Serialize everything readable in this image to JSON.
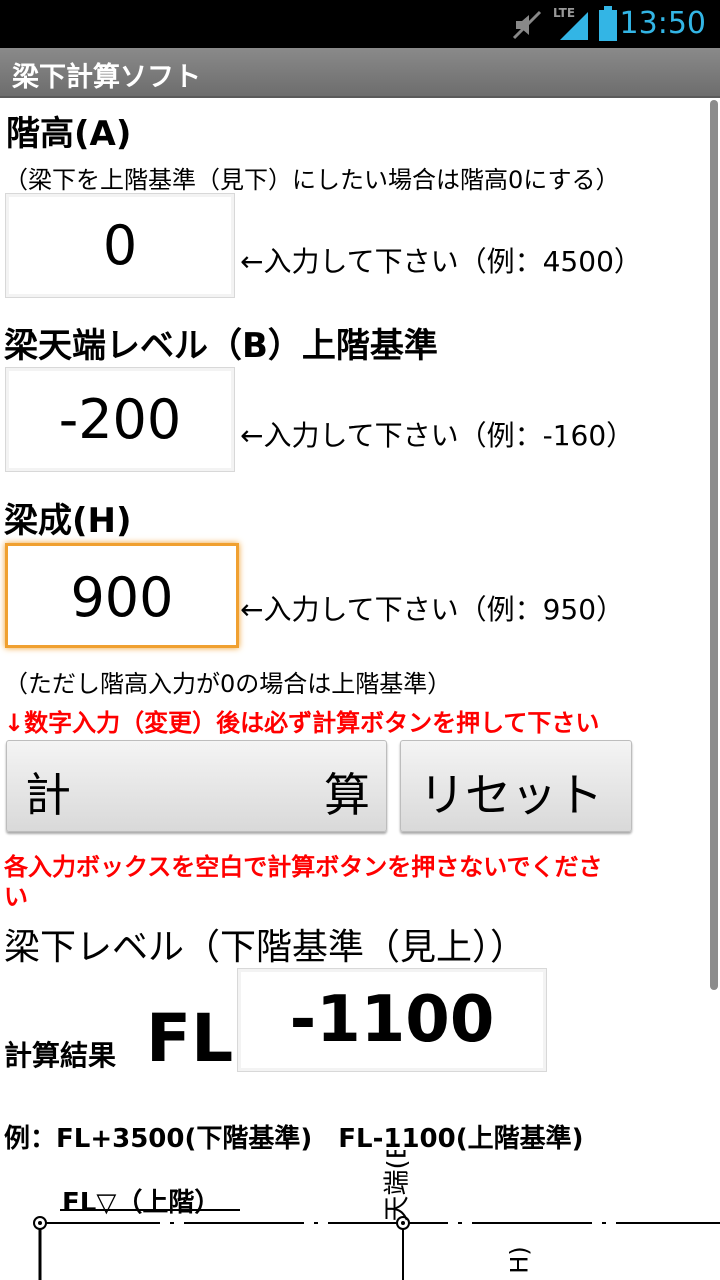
{
  "status_bar": {
    "time": "13:50",
    "network": "LTE",
    "icons": [
      "mute-icon",
      "signal-icon",
      "battery-icon"
    ],
    "accent": "#33b5e5"
  },
  "app": {
    "title": "梁下計算ソフト"
  },
  "floor_height": {
    "label": "階高(A)",
    "note": "（梁下を上階基準（見下）にしたい場合は階高0にする）",
    "value": "0",
    "hint": "←入力して下さい（例：4500）"
  },
  "beam_top": {
    "label": "梁天端レベル（B）上階基準",
    "value": "-200",
    "hint": "←入力して下さい（例：-160）"
  },
  "beam_depth": {
    "label": "梁成(H)",
    "value": "900",
    "hint": "←入力して下さい（例：950）",
    "note": "（ただし階高入力が0の場合は上階基準）"
  },
  "warning1": "↓数字入力（変更）後は必ず計算ボタンを押して下さい",
  "buttons": {
    "calc_left": "計",
    "calc_right": "算",
    "reset": "リセット"
  },
  "warning2_line1": "各入力ボックスを空白で計算ボタンを押さないでくださ",
  "warning2_line2": "い",
  "result": {
    "heading": "梁下レベル（下階基準（見上））",
    "label_small": "計算結果",
    "label_big": "FL",
    "value": "-1100"
  },
  "example": "例：FL+3500(下階基準)　FL-1100(上階基準)",
  "diagram": {
    "fl_label": "FL▽（上階）",
    "beam_label": "天端(B)",
    "partial": "H)"
  }
}
